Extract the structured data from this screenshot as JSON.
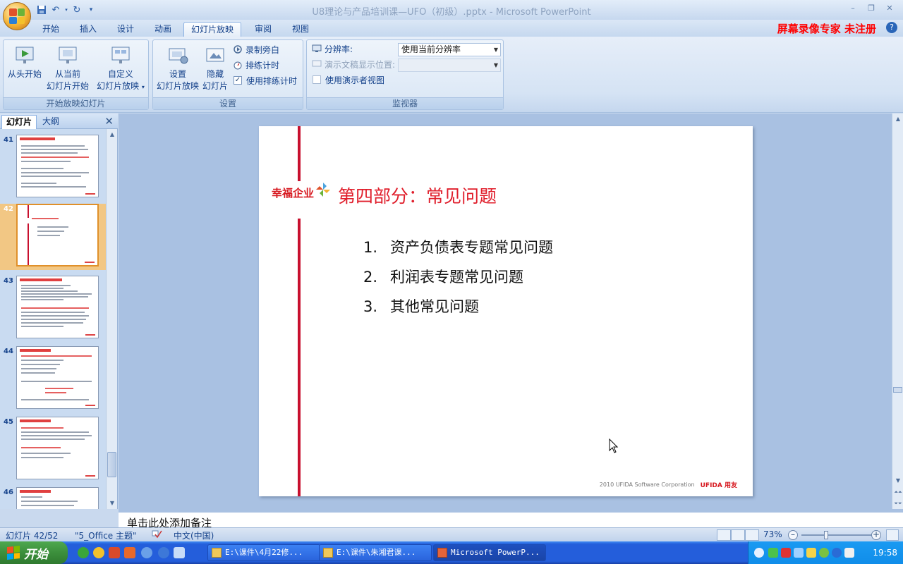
{
  "title_bar": {
    "document_title": "U8理论与产品培训课—UFO（初级）.pptx - Microsoft PowerPoint",
    "quick_access": [
      "save-icon",
      "undo-icon",
      "redo-icon",
      "customize-icon"
    ]
  },
  "watermark": "屏幕录像专家  未注册",
  "tabs": [
    "开始",
    "插入",
    "设计",
    "动画",
    "幻灯片放映",
    "审阅",
    "视图"
  ],
  "active_tab": "幻灯片放映",
  "ribbon": {
    "group1": {
      "label": "开始放映幻灯片",
      "btn_from_start": "从头开始",
      "btn_from_current_l1": "从当前",
      "btn_from_current_l2": "幻灯片开始",
      "btn_custom_l1": "自定义",
      "btn_custom_l2": "幻灯片放映"
    },
    "group2": {
      "label": "设置",
      "btn_setup_l1": "设置",
      "btn_setup_l2": "幻灯片放映",
      "btn_hide_l1": "隐藏",
      "btn_hide_l2": "幻灯片",
      "record_narration": "录制旁白",
      "rehearse_timings": "排练计时",
      "use_rehearsed_timings": "使用排练计时",
      "use_rehearsed_timings_checked": true
    },
    "group3": {
      "label": "监视器",
      "resolution_label": "分辨率:",
      "resolution_value": "使用当前分辨率",
      "show_on_label": "演示文稿显示位置:",
      "show_on_value": "",
      "presenter_view": "使用演示者视图",
      "presenter_view_checked": false
    }
  },
  "left_pane": {
    "tab_slides": "幻灯片",
    "tab_outline": "大纲",
    "thumbnails": [
      {
        "number": "41",
        "selected": false
      },
      {
        "number": "42",
        "selected": true
      },
      {
        "number": "43",
        "selected": false
      },
      {
        "number": "44",
        "selected": false
      },
      {
        "number": "45",
        "selected": false
      },
      {
        "number": "46",
        "selected": false
      }
    ]
  },
  "slide": {
    "logo_text": "幸福企业",
    "title": "第四部分：常见问题",
    "items": [
      {
        "num": "1.",
        "text": "资产负债表专题常见问题"
      },
      {
        "num": "2.",
        "text": "利润表专题常见问题"
      },
      {
        "num": "3.",
        "text": "其他常见问题"
      }
    ],
    "footer_text": "2010 UFIDA Software Corporation",
    "footer_brand": "UFIDA 用友"
  },
  "notes_placeholder": "单击此处添加备注",
  "status_bar": {
    "slide_info": "幻灯片 42/52",
    "theme": "\"5_Office 主题\"",
    "language": "中文(中国)",
    "zoom": "73%",
    "zoom_fraction": 0.35
  },
  "taskbar": {
    "start_label": "开始",
    "tasks": [
      {
        "label": "E:\\课件\\4月22修..."
      },
      {
        "label": "E:\\课件\\朱湘君课..."
      },
      {
        "label": "Microsoft PowerP..."
      }
    ],
    "clock": "19:58"
  },
  "colors": {
    "slide_red": "#c8102e",
    "title_red": "#e01e2b",
    "ribbon_text": "#15428b",
    "taskbar_blue": "#245edb"
  }
}
